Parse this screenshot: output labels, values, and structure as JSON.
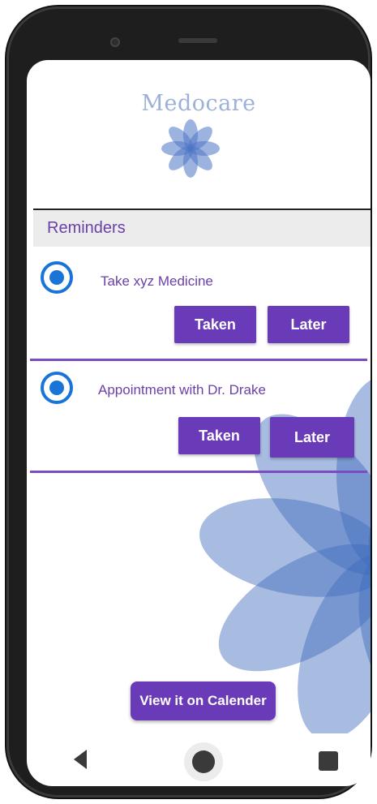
{
  "app": {
    "brand": "Medocare",
    "brand_color": "#9db1d8",
    "accent": "#6a3bb8",
    "radio_color": "#1a74d8"
  },
  "section": {
    "title": "Reminders"
  },
  "reminders": [
    {
      "label": "Take xyz Medicine",
      "selected": true,
      "taken_label": "Taken",
      "later_label": "Later"
    },
    {
      "label": "Appointment with Dr. Drake",
      "selected": true,
      "taken_label": "Taken",
      "later_label": "Later"
    }
  ],
  "footer": {
    "calendar_label": "View it on Calender"
  },
  "navigation": {
    "back": "back-icon",
    "home": "home-icon",
    "recents": "recents-icon"
  }
}
